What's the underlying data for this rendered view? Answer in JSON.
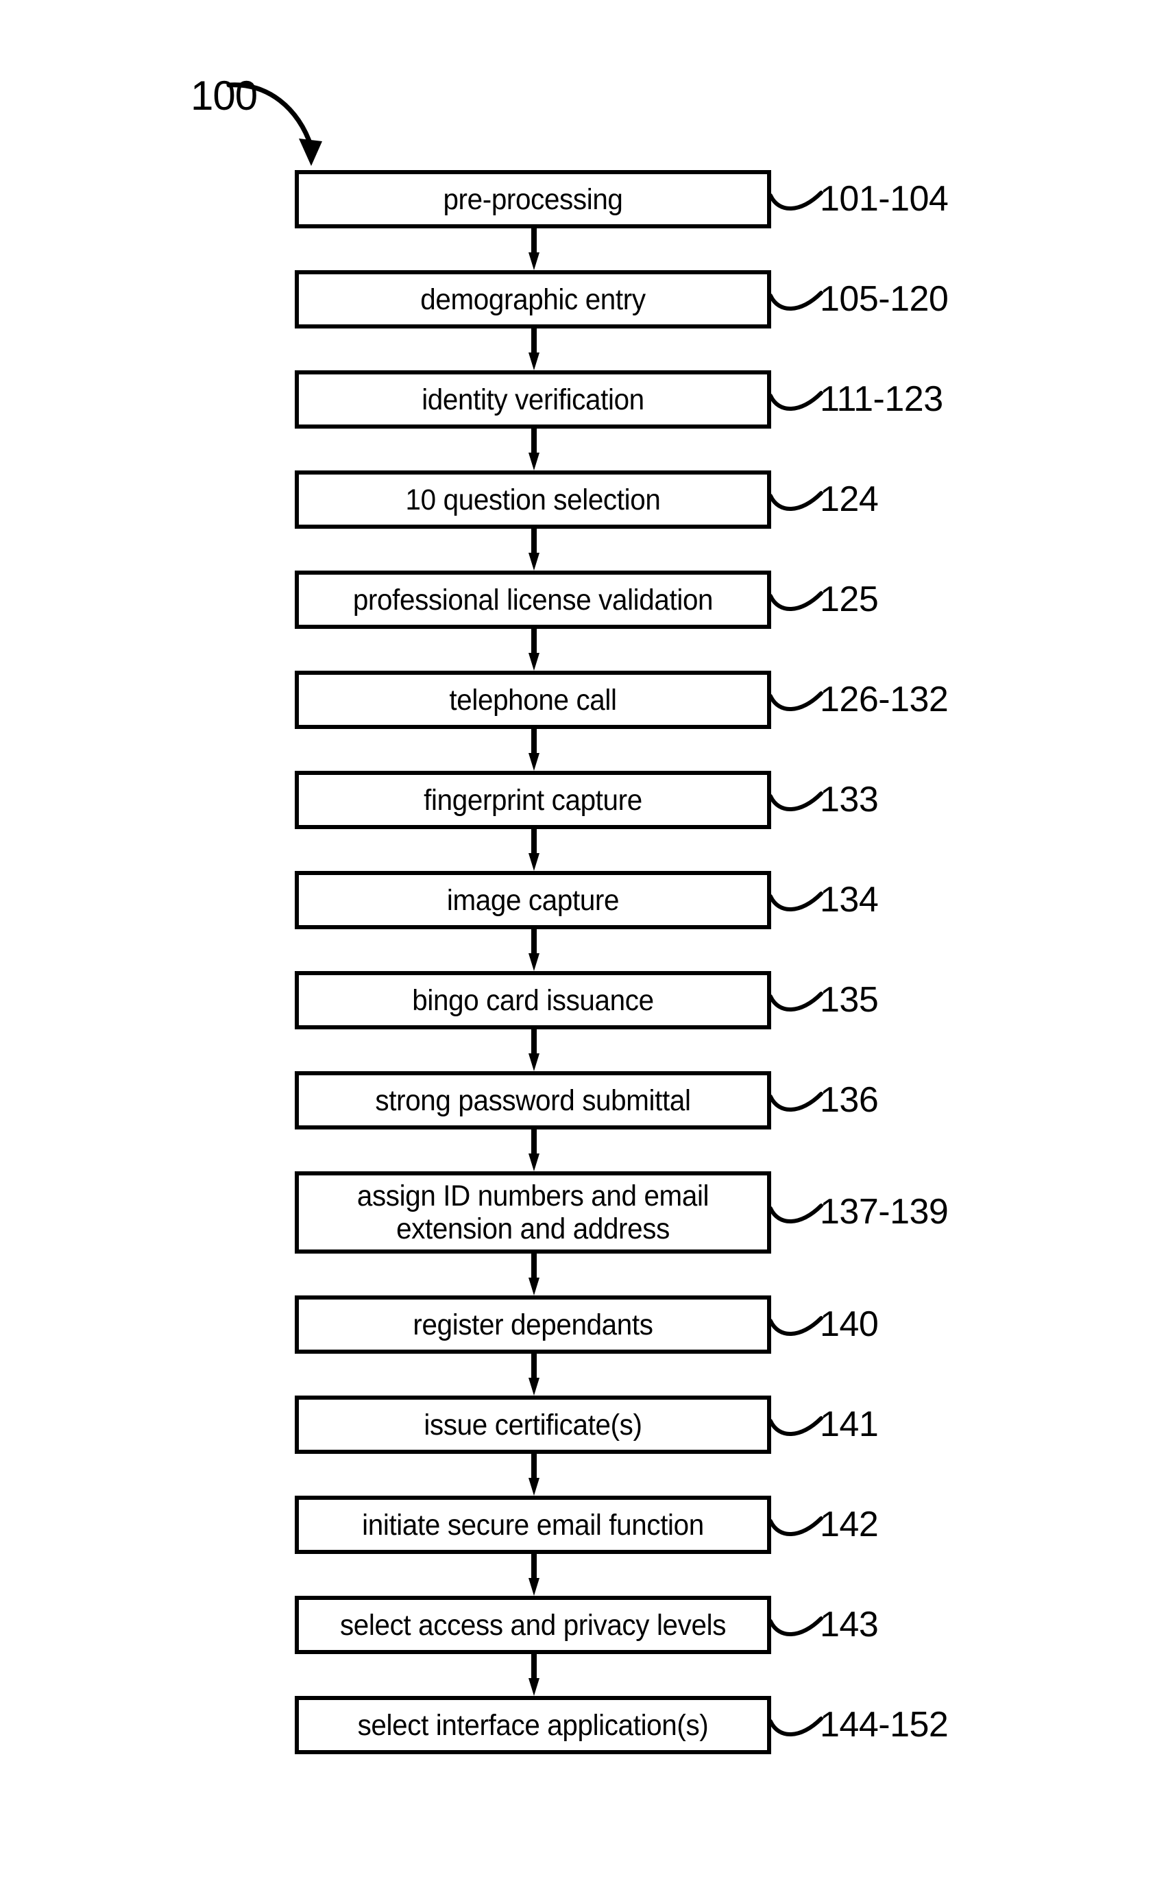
{
  "figure": {
    "number_label": "100",
    "background_color": "#ffffff",
    "line_color": "#000000"
  },
  "flowchart": {
    "type": "vertical-sequential-flowchart",
    "orientation": "top-to-bottom",
    "steps": [
      {
        "label": "pre-processing",
        "ref": "101-104",
        "lines": 1
      },
      {
        "label": "demographic entry",
        "ref": "105-120",
        "lines": 1
      },
      {
        "label": "identity verification",
        "ref": "111-123",
        "lines": 1
      },
      {
        "label": "10 question selection",
        "ref": "124",
        "lines": 1
      },
      {
        "label": "professional license validation",
        "ref": "125",
        "lines": 1
      },
      {
        "label": "telephone call",
        "ref": "126-132",
        "lines": 1
      },
      {
        "label": "fingerprint capture",
        "ref": "133",
        "lines": 1
      },
      {
        "label": "image capture",
        "ref": "134",
        "lines": 1
      },
      {
        "label": "bingo card issuance",
        "ref": "135",
        "lines": 1
      },
      {
        "label": "strong password submittal",
        "ref": "136",
        "lines": 1
      },
      {
        "label": "assign ID numbers and email\nextension and address",
        "ref": "137-139",
        "lines": 2
      },
      {
        "label": "register dependants",
        "ref": "140",
        "lines": 1
      },
      {
        "label": "issue certificate(s)",
        "ref": "141",
        "lines": 1
      },
      {
        "label": "initiate secure email function",
        "ref": "142",
        "lines": 1
      },
      {
        "label": "select access and privacy levels",
        "ref": "143",
        "lines": 1
      },
      {
        "label": "select interface application(s)",
        "ref": "144-152",
        "lines": 1
      }
    ]
  }
}
